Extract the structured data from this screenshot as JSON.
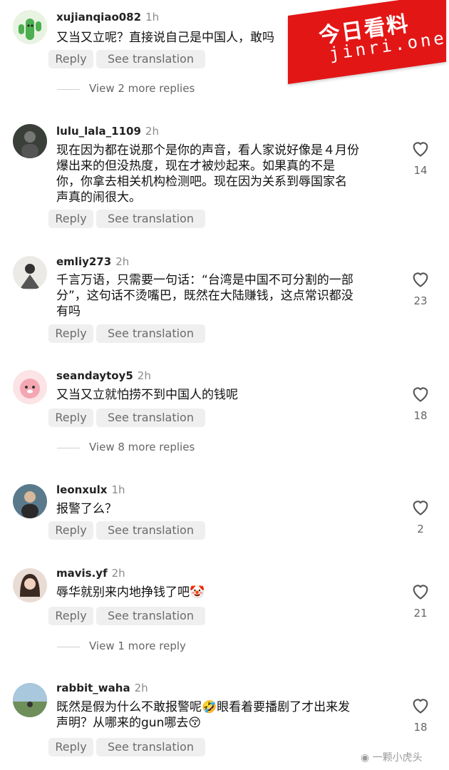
{
  "actions": {
    "reply": "Reply",
    "see_translation": "See translation"
  },
  "comments": [
    {
      "username": "xujianqiao082",
      "time": "1h",
      "text": "又当又立呢？直接说自己是中国人，敢吗",
      "likes": "",
      "more_replies": "View 2 more replies",
      "avatar_color": "#4caf50"
    },
    {
      "username": "lulu_lala_1109",
      "time": "2h",
      "text": "现在因为都在说那个是你的声音，看人家说好像是４月份\n爆出来的但没热度，现在才被炒起来。如果真的不是\n你，你拿去相关机构检测吧。现在因为关系到辱国家名\n声真的闹很大。",
      "likes": "14",
      "more_replies": "",
      "avatar_color": "#3a3f3a"
    },
    {
      "username": "emliy273",
      "time": "2h",
      "text": "千言万语，只需要一句话：“台湾是中国不可分割的一部\n分”，这句话不烫嘴巴，既然在大陆赚钱，这点常识都没\n有吗",
      "likes": "23",
      "more_replies": "",
      "avatar_color": "#c9c2b8"
    },
    {
      "username": "seandaytoy5",
      "time": "2h",
      "text": "又当又立就怕捞不到中国人的钱呢",
      "likes": "18",
      "more_replies": "View 8 more replies",
      "avatar_color": "#f4c6cc"
    },
    {
      "username": "leonxulx",
      "time": "1h",
      "text": "报警了么？",
      "likes": "2",
      "more_replies": "",
      "avatar_color": "#5a7a8c"
    },
    {
      "username": "mavis.yf",
      "time": "2h",
      "text": "辱华就别来内地挣钱了吧🤡",
      "likes": "21",
      "more_replies": "View 1 more reply",
      "avatar_color": "#8a6e62"
    },
    {
      "username": "rabbit_waha",
      "time": "2h",
      "text": "既然是假为什么不敢报警呢🤣眼看着要播剧了才出来发\n声明？从哪来的gun哪去😚",
      "likes": "18",
      "more_replies": "",
      "avatar_color": "#8fb0c8"
    }
  ],
  "overlay": {
    "logo_title": "今日看料",
    "logo_sub": "jinri.one",
    "logo_color": "#e31616",
    "watermark": "一颗小虎头"
  }
}
